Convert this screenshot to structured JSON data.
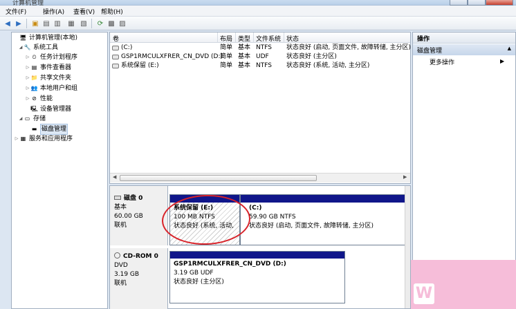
{
  "window": {
    "title": "计算机管理"
  },
  "menu": [
    "文件(F)",
    "操作(A)",
    "查看(V)",
    "帮助(H)"
  ],
  "tree": {
    "root": "计算机管理(本地)",
    "system_tools": "系统工具",
    "task_scheduler": "任务计划程序",
    "event_viewer": "事件查看器",
    "shared_folders": "共享文件夹",
    "local_users": "本地用户和组",
    "performance": "性能",
    "device_manager": "设备管理器",
    "storage": "存储",
    "disk_management": "磁盘管理",
    "services_apps": "服务和应用程序"
  },
  "volume_list": {
    "headers": [
      "卷",
      "布局",
      "类型",
      "文件系统",
      "状态"
    ],
    "rows": [
      [
        "(C:)",
        "简单",
        "基本",
        "NTFS",
        "状态良好 (启动, 页面文件, 故障转储, 主分区)"
      ],
      [
        "GSP1RMCULXFRER_CN_DVD (D:)",
        "简单",
        "基本",
        "UDF",
        "状态良好 (主分区)"
      ],
      [
        "系统保留 (E:)",
        "简单",
        "基本",
        "NTFS",
        "状态良好 (系统, 活动, 主分区)"
      ]
    ]
  },
  "disks": [
    {
      "name": "磁盘 0",
      "type": "基本",
      "size": "60.00 GB",
      "status": "联机",
      "partitions": [
        {
          "title": "系统保留  (E:)",
          "size": "100 MB NTFS",
          "status": "状态良好 (系统, 活动, 主"
        },
        {
          "title": "(C:)",
          "size": "59.90 GB NTFS",
          "status": "状态良好 (启动, 页面文件, 故障转储, 主分区)"
        }
      ]
    },
    {
      "name": "CD-ROM 0",
      "type": "DVD",
      "size": "3.19 GB",
      "status": "联机",
      "partitions": [
        {
          "title": "GSP1RMCULXFRER_CN_DVD  (D:)",
          "size": "3.19 GB UDF",
          "status": "状态良好 (主分区)"
        }
      ]
    }
  ],
  "actions": {
    "header": "操作",
    "section": "磁盘管理",
    "more": "更多操作"
  },
  "colors": {
    "partition_bar": "#10168a",
    "annotation": "#d8232a",
    "watermark_bg": "#f6bdd9"
  }
}
